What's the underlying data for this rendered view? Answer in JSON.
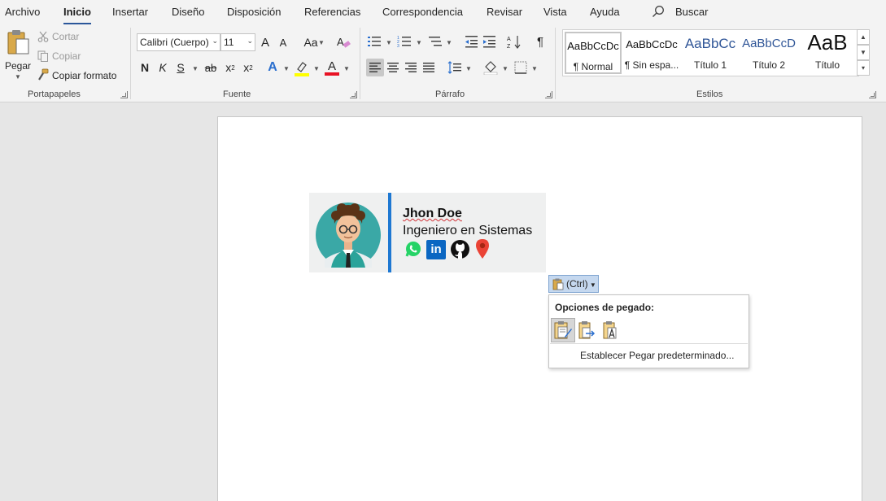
{
  "menu": {
    "tabs": [
      "Archivo",
      "Inicio",
      "Insertar",
      "Diseño",
      "Disposición",
      "Referencias",
      "Correspondencia",
      "Revisar",
      "Vista",
      "Ayuda"
    ],
    "active_tab": "Inicio",
    "search_label": "Buscar"
  },
  "clipboard": {
    "paste_label": "Pegar",
    "cut_label": "Cortar",
    "copy_label": "Copiar",
    "format_painter_label": "Copiar formato",
    "group_label": "Portapapeles"
  },
  "font": {
    "font_name": "Calibri (Cuerpo)",
    "font_size": "11",
    "grow_font": "A",
    "shrink_font": "A",
    "change_case": "Aa",
    "bold": "N",
    "italic": "K",
    "underline": "S",
    "strikethrough": "ab",
    "subscript": "x",
    "superscript": "x",
    "text_effects": "A",
    "font_color": "A",
    "group_label": "Fuente"
  },
  "paragraph": {
    "pilcrow": "¶",
    "group_label": "Párrafo"
  },
  "styles": {
    "items": [
      {
        "sample": "AaBbCcDc",
        "name": "¶ Normal"
      },
      {
        "sample": "AaBbCcDc",
        "name": "¶ Sin espa..."
      },
      {
        "sample": "AaBbCc",
        "name": "Título 1"
      },
      {
        "sample": "AaBbCcD",
        "name": "Título 2"
      },
      {
        "sample": "AaB",
        "name": "Título"
      }
    ],
    "group_label": "Estilos"
  },
  "document": {
    "signature_name": "Jhon Doe",
    "signature_role": "Ingeniero en Sistemas",
    "linkedin_text": "in"
  },
  "paste_options": {
    "ctrl_label": "(Ctrl)",
    "title": "Opciones de pegado:",
    "set_default_label": "Establecer Pegar predeterminado..."
  },
  "colors": {
    "accent": "#2b579a",
    "signature_bar": "#1e78d2",
    "highlight": "#ffff00",
    "font_color": "#e81123",
    "whatsapp": "#25d366",
    "linkedin": "#0a66c2",
    "location": "#ea4335",
    "avatar_bg": "#3aa8a6"
  },
  "icons": {
    "search": "search-icon",
    "paste": "clipboard-icon",
    "cut": "scissors-icon",
    "copy": "copy-icon",
    "format_painter": "paintbrush-icon",
    "whatsapp": "whatsapp-icon",
    "linkedin": "linkedin-icon",
    "github": "github-icon",
    "location": "location-pin-icon"
  }
}
